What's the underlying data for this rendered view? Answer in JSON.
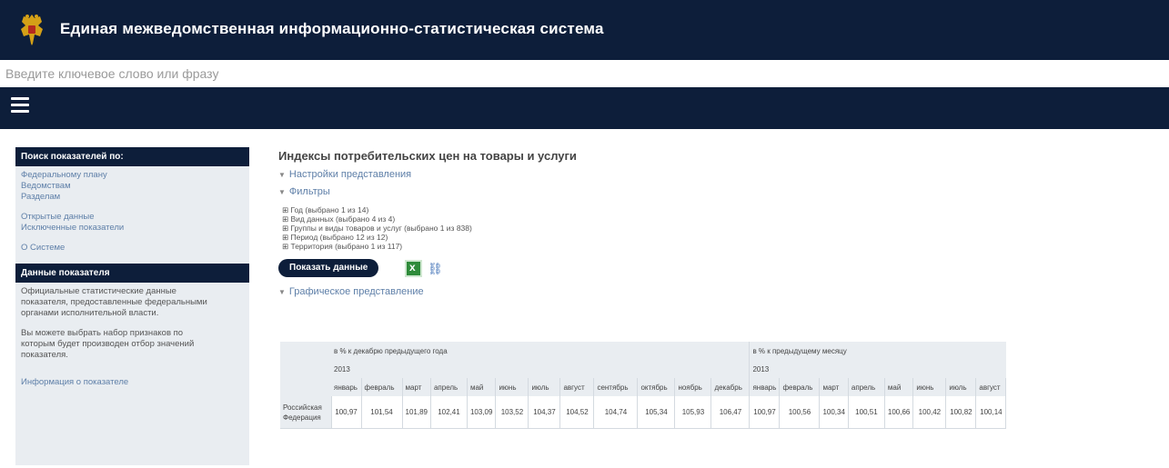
{
  "header": {
    "title": "Единая межведомственная информационно-статистическая система"
  },
  "search": {
    "placeholder": "Введите ключевое слово или фразу"
  },
  "sidebar": {
    "section1_title": "Поиск показателей по:",
    "links1": [
      "Федеральному плану",
      "Ведомствам",
      "Разделам"
    ],
    "links2": [
      "Открытые данные",
      "Исключенные показатели"
    ],
    "links3": [
      "О Системе"
    ],
    "section2_title": "Данные показателя",
    "text1": [
      "Официальные статистические данные",
      "показателя, предоставленные федеральными",
      "органами исполнительной власти."
    ],
    "text2": [
      "Вы можете выбрать набор признаков по",
      "которым будет производен отбор значений",
      "показателя."
    ],
    "info_link": "Информация о показателе"
  },
  "content": {
    "title": "Индексы потребительских цен на товары и услуги",
    "settings_label": "Настройки представления",
    "filters_label": "Фильтры",
    "filters": [
      "⊞ Год (выбрано 1 из 14)",
      "⊞ Вид данных (выбрано 4 из 4)",
      "⊞ Группы и виды товаров и услуг (выбрано 1 из 838)",
      "⊞ Период (выбрано 12 из 12)",
      "⊞ Территория (выбрано 1 из 117)"
    ],
    "show_button": "Показать данные",
    "graph_label": "Графическое представление"
  },
  "table": {
    "group1": "в % к декабрю предыдущего года",
    "group2": "в % к предыдущему месяцу",
    "year": "2013",
    "months": [
      "январь",
      "февраль",
      "март",
      "апрель",
      "май",
      "июнь",
      "июль",
      "август",
      "сентябрь",
      "октябрь",
      "ноябрь",
      "декабрь"
    ],
    "months2": [
      "январь",
      "февраль",
      "март",
      "апрель",
      "май",
      "июнь",
      "июль",
      "август"
    ],
    "region": "Российская Федерация",
    "values1": [
      "100,97",
      "101,54",
      "101,89",
      "102,41",
      "103,09",
      "103,52",
      "104,37",
      "104,52",
      "104,74",
      "105,34",
      "105,93",
      "106,47"
    ],
    "values2": [
      "100,97",
      "100,56",
      "100,34",
      "100,51",
      "100,66",
      "100,42",
      "100,82",
      "100,14"
    ]
  }
}
